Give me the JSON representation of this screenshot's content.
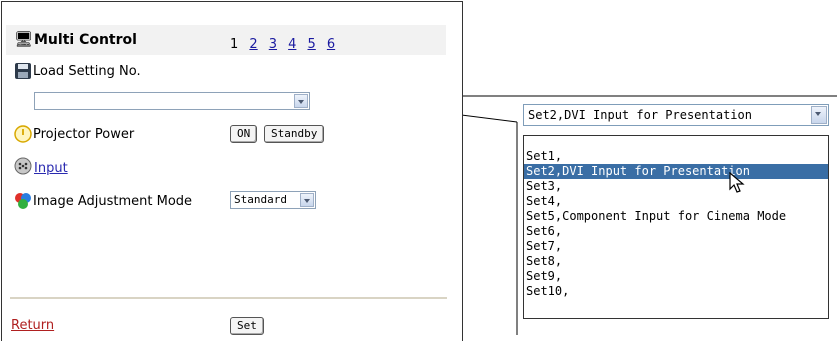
{
  "header": {
    "title": "Multi Control",
    "pages": [
      {
        "label": "1",
        "link": false
      },
      {
        "label": "2",
        "link": true
      },
      {
        "label": "3",
        "link": true
      },
      {
        "label": "4",
        "link": true
      },
      {
        "label": "5",
        "link": true
      },
      {
        "label": "6",
        "link": true
      }
    ]
  },
  "load_setting": {
    "label": "Load Setting No.",
    "value": ""
  },
  "power": {
    "label": "Projector Power",
    "on_label": "ON",
    "standby_label": "Standby"
  },
  "input": {
    "label": "Input"
  },
  "image_mode": {
    "label": "Image Adjustment Mode",
    "value": "Standard"
  },
  "footer": {
    "return_label": "Return",
    "set_label": "Set"
  },
  "dropdown": {
    "selected": "Set2,DVI Input for Presentation",
    "options": [
      "Set1,",
      "Set2,DVI Input for Presentation",
      "Set3,",
      "Set4,",
      "Set5,Component Input for Cinema Mode",
      "Set6,",
      "Set7,",
      "Set8,",
      "Set9,",
      "Set10,"
    ],
    "highlighted_index": 1
  }
}
